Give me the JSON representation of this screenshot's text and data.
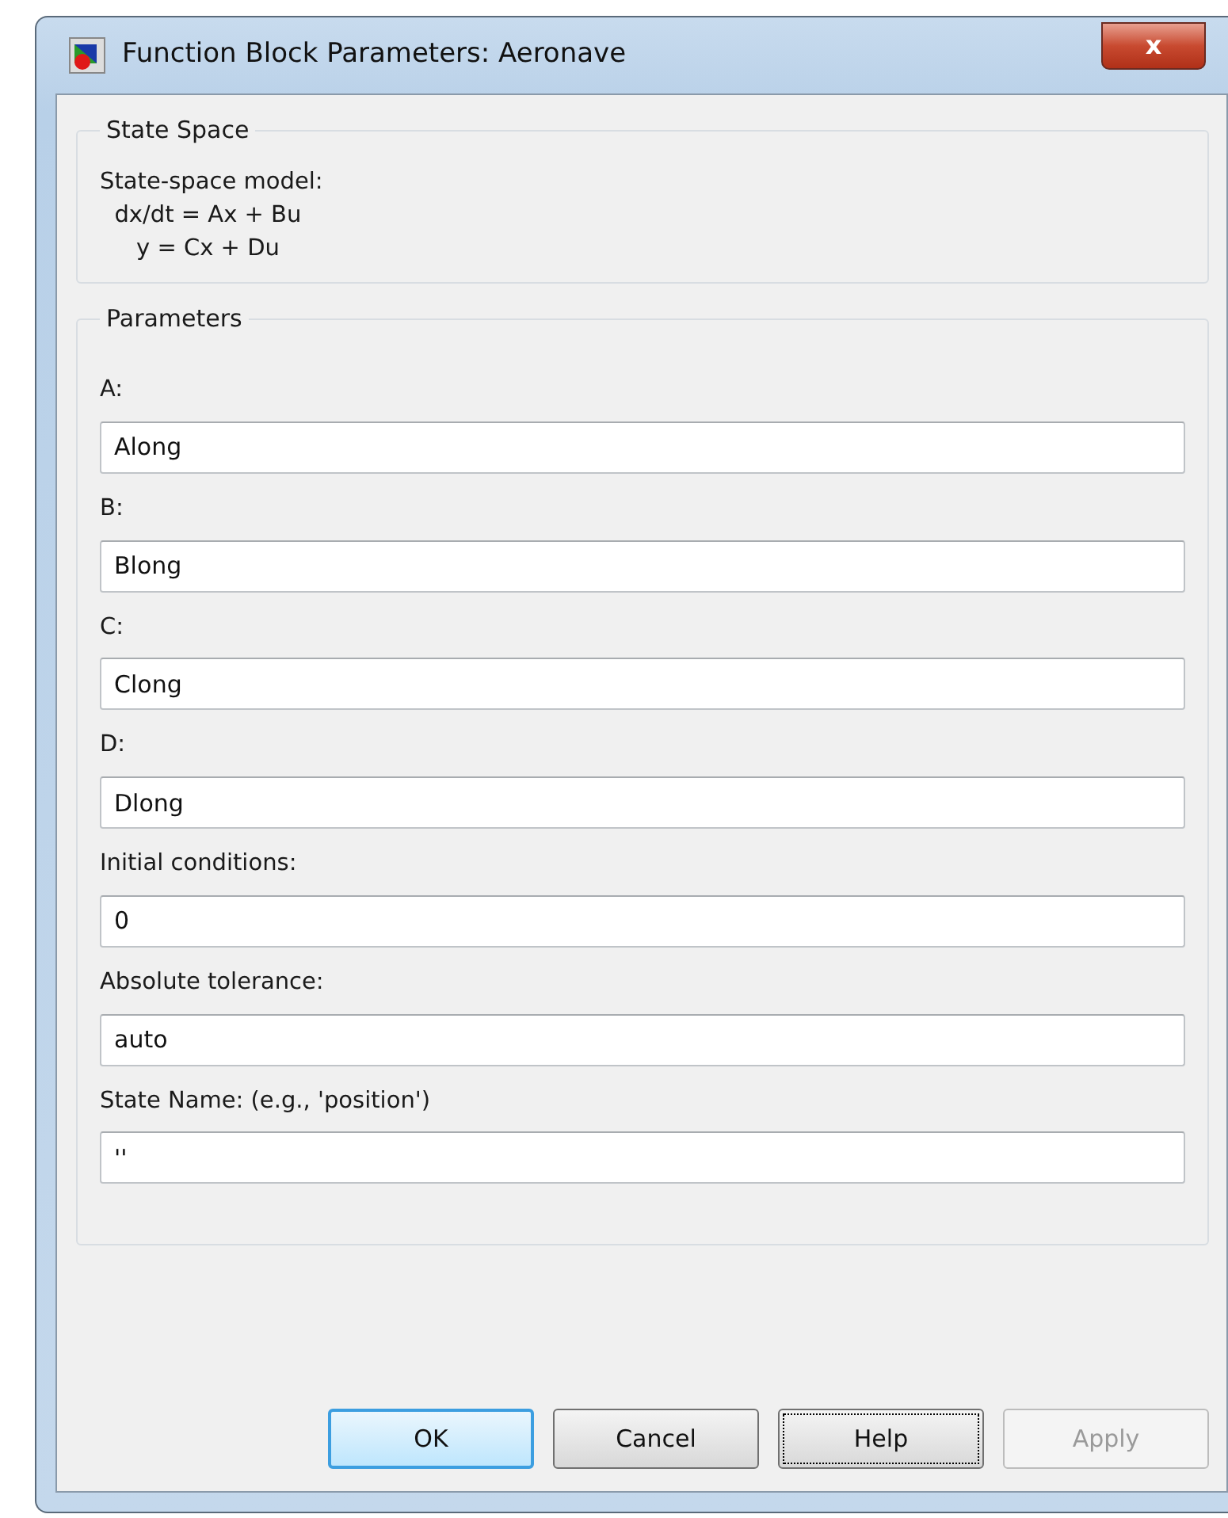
{
  "window": {
    "title": "Function Block Parameters: Aeronave",
    "close_button": "x"
  },
  "description": {
    "legend": "State Space",
    "lines": [
      "State-space model:",
      "  dx/dt = Ax + Bu",
      "     y = Cx + Du"
    ]
  },
  "parameters": {
    "legend": "Parameters",
    "fields": [
      {
        "label": "A:",
        "value": "Along"
      },
      {
        "label": "B:",
        "value": "Blong"
      },
      {
        "label": "C:",
        "value": "Clong"
      },
      {
        "label": "D:",
        "value": "Dlong"
      },
      {
        "label": "Initial conditions:",
        "value": "0"
      },
      {
        "label": "Absolute tolerance:",
        "value": "auto"
      },
      {
        "label": "State Name: (e.g., 'position')",
        "value": "''"
      }
    ]
  },
  "buttons": [
    {
      "label": "OK",
      "default": true,
      "focused": false,
      "disabled": false
    },
    {
      "label": "Cancel",
      "default": false,
      "focused": false,
      "disabled": false
    },
    {
      "label": "Help",
      "default": false,
      "focused": true,
      "disabled": false
    },
    {
      "label": "Apply",
      "default": false,
      "focused": false,
      "disabled": true
    }
  ]
}
